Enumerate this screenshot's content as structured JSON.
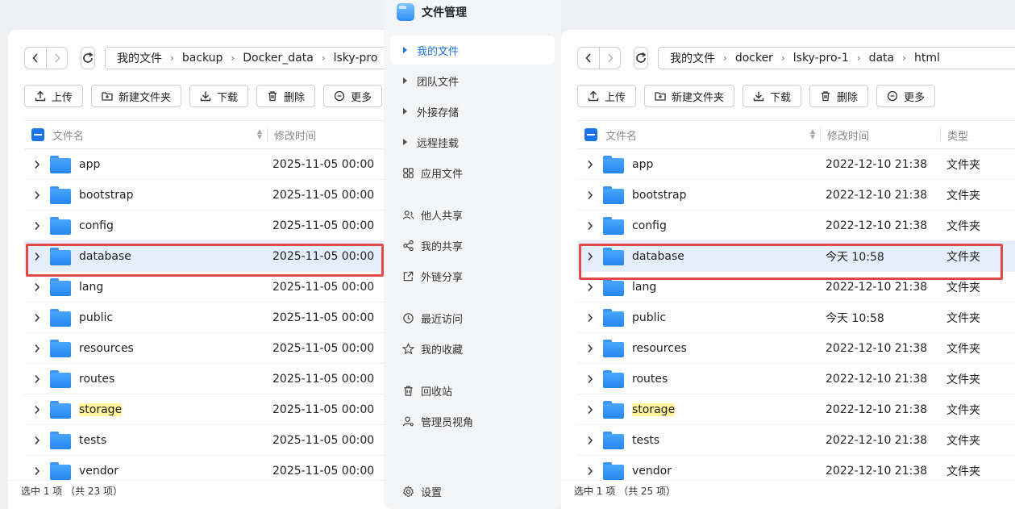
{
  "app": {
    "title": "文件管理"
  },
  "sidebar": {
    "items": [
      {
        "label": "我的文件",
        "icon": "caret-right-icon",
        "active": true
      },
      {
        "label": "团队文件",
        "icon": "caret-right-icon"
      },
      {
        "label": "外接存储",
        "icon": "caret-right-icon"
      },
      {
        "label": "远程挂载",
        "icon": "caret-right-icon"
      },
      {
        "label": "应用文件",
        "icon": "apps-grid-icon"
      },
      {
        "label": "他人共享",
        "icon": "users-icon"
      },
      {
        "label": "我的共享",
        "icon": "share-icon"
      },
      {
        "label": "外链分享",
        "icon": "external-link-icon"
      },
      {
        "label": "最近访问",
        "icon": "clock-icon"
      },
      {
        "label": "我的收藏",
        "icon": "star-icon"
      },
      {
        "label": "回收站",
        "icon": "trash-icon"
      },
      {
        "label": "管理员视角",
        "icon": "admin-icon"
      }
    ],
    "settings_label": "设置"
  },
  "actions": {
    "upload": "上传",
    "new_folder": "新建文件夹",
    "download": "下载",
    "delete": "删除",
    "more": "更多"
  },
  "columns": {
    "name": "文件名",
    "modified": "修改时间",
    "type": "类型"
  },
  "left": {
    "breadcrumb": [
      "我的文件",
      "backup",
      "Docker_data",
      "lsky-pro"
    ],
    "rows": [
      {
        "name": "app",
        "date": "2025-11-05 00:00"
      },
      {
        "name": "bootstrap",
        "date": "2025-11-05 00:00"
      },
      {
        "name": "config",
        "date": "2025-11-05 00:00"
      },
      {
        "name": "database",
        "date": "2025-11-05 00:00"
      },
      {
        "name": "lang",
        "date": "2025-11-05 00:00"
      },
      {
        "name": "public",
        "date": "2025-11-05 00:00"
      },
      {
        "name": "resources",
        "date": "2025-11-05 00:00"
      },
      {
        "name": "routes",
        "date": "2025-11-05 00:00"
      },
      {
        "name": "storage",
        "date": "2025-11-05 00:00"
      },
      {
        "name": "tests",
        "date": "2025-11-05 00:00"
      },
      {
        "name": "vendor",
        "date": "2025-11-05 00:00"
      }
    ],
    "status": "选中 1 项 （共 23 项）"
  },
  "right": {
    "breadcrumb": [
      "我的文件",
      "docker",
      "lsky-pro-1",
      "data",
      "html"
    ],
    "rows": [
      {
        "name": "app",
        "date": "2022-12-10 21:38",
        "type": "文件夹"
      },
      {
        "name": "bootstrap",
        "date": "2022-12-10 21:38",
        "type": "文件夹"
      },
      {
        "name": "config",
        "date": "2022-12-10 21:38",
        "type": "文件夹"
      },
      {
        "name": "database",
        "date": "今天 10:58",
        "type": "文件夹"
      },
      {
        "name": "lang",
        "date": "2022-12-10 21:38",
        "type": "文件夹"
      },
      {
        "name": "public",
        "date": "今天 10:58",
        "type": "文件夹"
      },
      {
        "name": "resources",
        "date": "2022-12-10 21:38",
        "type": "文件夹"
      },
      {
        "name": "routes",
        "date": "2022-12-10 21:38",
        "type": "文件夹"
      },
      {
        "name": "storage",
        "date": "2022-12-10 21:38",
        "type": "文件夹"
      },
      {
        "name": "tests",
        "date": "2022-12-10 21:38",
        "type": "文件夹"
      },
      {
        "name": "vendor",
        "date": "2022-12-10 21:38",
        "type": "文件夹"
      }
    ],
    "status": "选中 1 项 （共 25 项）"
  },
  "colors": {
    "accent": "#1a73e8",
    "selected_row": "#e4eefc",
    "highlight": "#fff59a",
    "annotation": "#e24a4a"
  }
}
